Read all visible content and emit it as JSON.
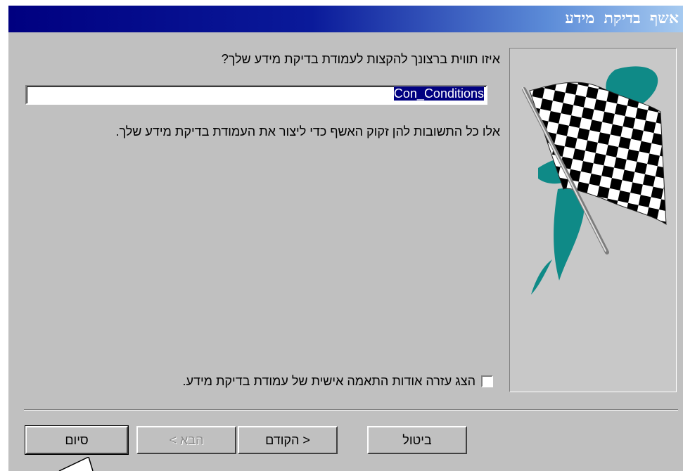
{
  "window": {
    "title": "אשף בדיקת מידע"
  },
  "question": "איזו תווית ברצונך להקצות לעמודת בדיקת מידע שלך?",
  "name_input": {
    "value": "Con_Conditions"
  },
  "info_text": "אלו כל התשובות להן זקוק האשף כדי ליצור את העמודת בדיקת מידע שלך.",
  "checkbox": {
    "label": "הצג עזרה אודות התאמה אישית של עמודת בדיקת מידע.",
    "checked": false
  },
  "buttons": {
    "finish": "סיום",
    "next": "הבא >",
    "back": "< הקודם",
    "cancel": "ביטול"
  },
  "colors": {
    "titlebar": "#000080",
    "dialog": "#c0c0c0",
    "flag_accent": "#0f8a87"
  }
}
